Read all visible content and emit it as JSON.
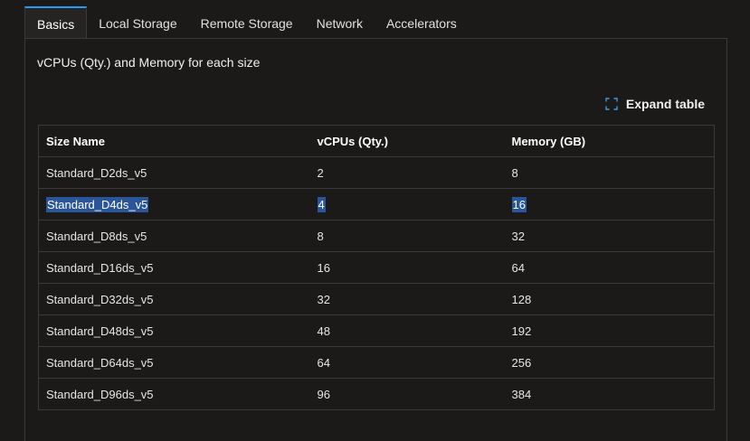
{
  "tabs": [
    {
      "label": "Basics",
      "active": true
    },
    {
      "label": "Local Storage",
      "active": false
    },
    {
      "label": "Remote Storage",
      "active": false
    },
    {
      "label": "Network",
      "active": false
    },
    {
      "label": "Accelerators",
      "active": false
    }
  ],
  "panel": {
    "title": "vCPUs (Qty.) and Memory for each size",
    "expand_label": "Expand table",
    "expand_icon": "expand-icon"
  },
  "table": {
    "headers": [
      "Size Name",
      "vCPUs (Qty.)",
      "Memory (GB)"
    ],
    "rows": [
      [
        "Standard_D2ds_v5",
        "2",
        "8"
      ],
      [
        "Standard_D4ds_v5",
        "4",
        "16"
      ],
      [
        "Standard_D8ds_v5",
        "8",
        "32"
      ],
      [
        "Standard_D16ds_v5",
        "16",
        "64"
      ],
      [
        "Standard_D32ds_v5",
        "32",
        "128"
      ],
      [
        "Standard_D48ds_v5",
        "48",
        "192"
      ],
      [
        "Standard_D64ds_v5",
        "64",
        "256"
      ],
      [
        "Standard_D96ds_v5",
        "96",
        "384"
      ]
    ],
    "selected_row_index": 1
  },
  "colors": {
    "background": "#1b1a19",
    "accent": "#2899f5",
    "selection": "#2a5699",
    "border": "#3b3a39"
  }
}
